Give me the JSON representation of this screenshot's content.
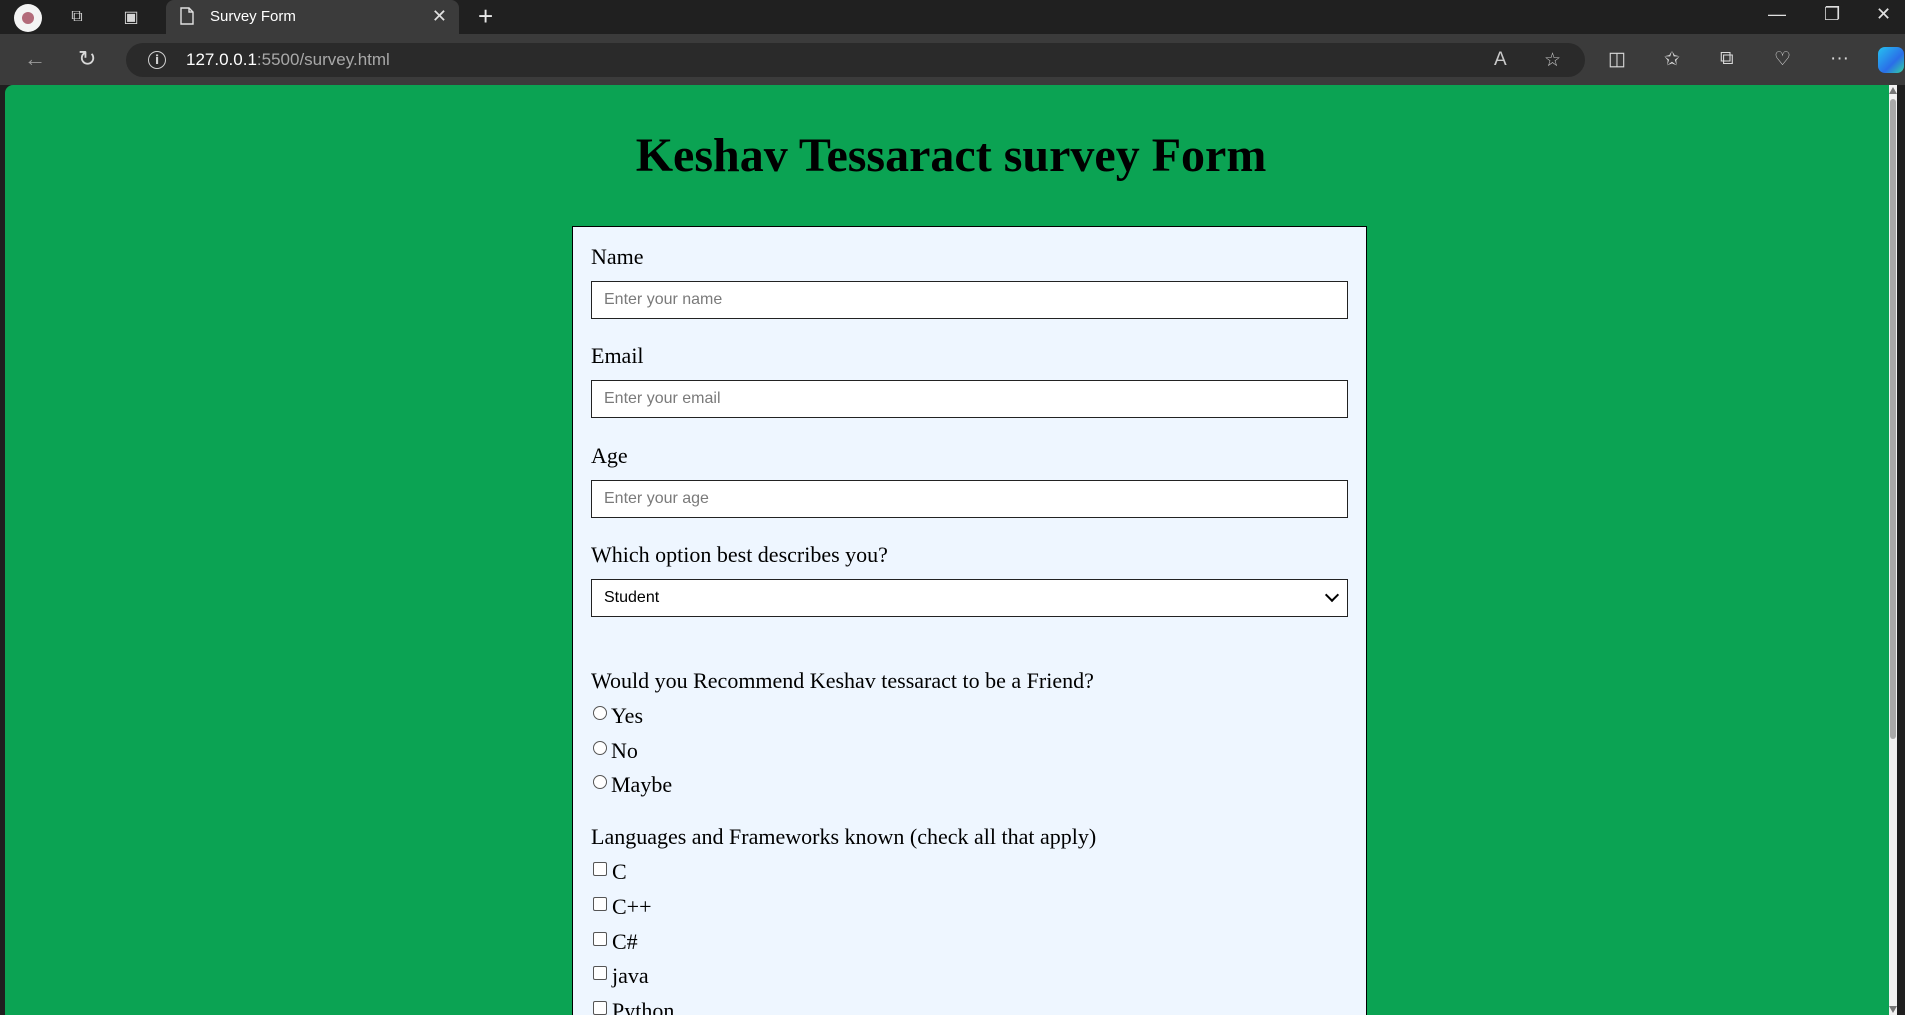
{
  "browser": {
    "tab_title": "Survey Form",
    "url_host": "127.0.0.1",
    "url_rest": ":5500/survey.html"
  },
  "page": {
    "title": "Keshav Tessaract survey Form",
    "bg_color": "#0ba353",
    "card_color": "#eef6ff"
  },
  "form": {
    "name_label": "Name",
    "name_placeholder": "Enter your name",
    "email_label": "Email",
    "email_placeholder": "Enter your email",
    "age_label": "Age",
    "age_placeholder": "Enter your age",
    "role_label": "Which option best describes you?",
    "role_selected": "Student",
    "recommend_label": "Would you Recommend Keshav tessaract to be a Friend?",
    "recommend_options": [
      "Yes",
      "No",
      "Maybe"
    ],
    "languages_label": "Languages and Frameworks known (check all that apply)",
    "languages": [
      "C",
      "C++",
      "C#",
      "java",
      "Python"
    ]
  }
}
